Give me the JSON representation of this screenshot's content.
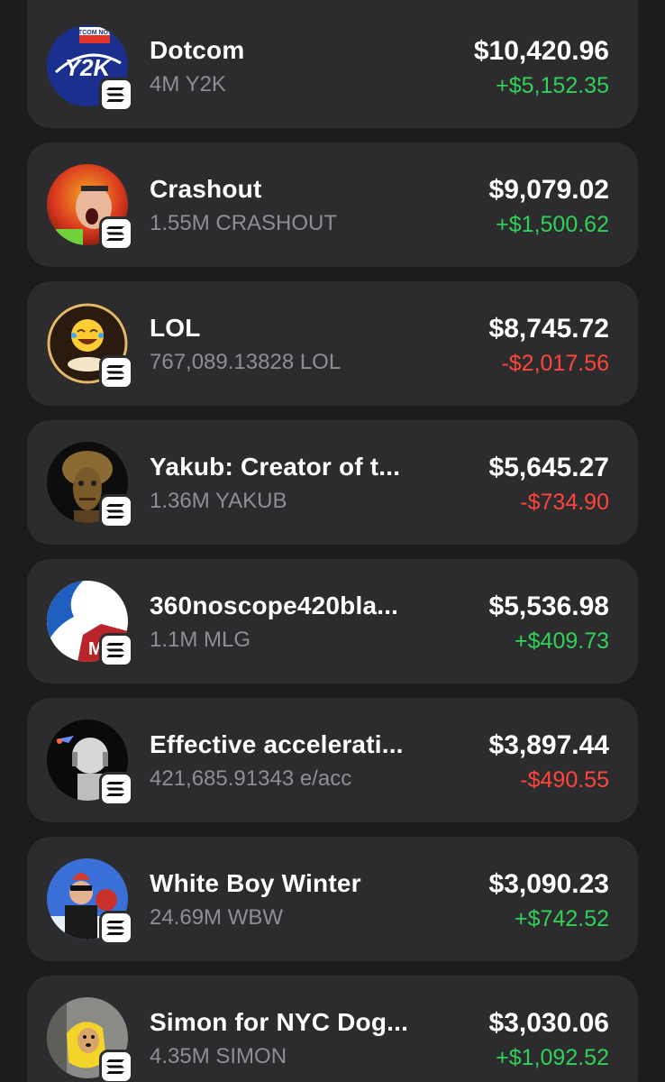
{
  "colors": {
    "background": "#1c1c1e",
    "card": "#2c2c2e",
    "positive": "#30d158",
    "negative": "#ff453a",
    "secondary_text": "#8e8e93"
  },
  "tokens": [
    {
      "name": "Dotcom",
      "amount": "4M Y2K",
      "value": "$10,420.96",
      "change": "+$5,152.35",
      "direction": "up",
      "avatar_text": "Y2K",
      "avatar_caption": "DOTCOM NOW!!!"
    },
    {
      "name": "Crashout",
      "amount": "1.55M CRASHOUT",
      "value": "$9,079.02",
      "change": "+$1,500.62",
      "direction": "up"
    },
    {
      "name": "LOL",
      "amount": "767,089.13828 LOL",
      "value": "$8,745.72",
      "change": "-$2,017.56",
      "direction": "down"
    },
    {
      "name": "Yakub: Creator of t...",
      "amount": "1.36M YAKUB",
      "value": "$5,645.27",
      "change": "-$734.90",
      "direction": "down"
    },
    {
      "name": "360noscope420bla...",
      "amount": "1.1M MLG",
      "value": "$5,536.98",
      "change": "+$409.73",
      "direction": "up",
      "avatar_text": "M"
    },
    {
      "name": "Effective accelerati...",
      "amount": "421,685.91343 e/acc",
      "value": "$3,897.44",
      "change": "-$490.55",
      "direction": "down"
    },
    {
      "name": "White Boy Winter",
      "amount": "24.69M WBW",
      "value": "$3,090.23",
      "change": "+$742.52",
      "direction": "up"
    },
    {
      "name": "Simon for NYC Dog...",
      "amount": "4.35M SIMON",
      "value": "$3,030.06",
      "change": "+$1,092.52",
      "direction": "up"
    }
  ]
}
